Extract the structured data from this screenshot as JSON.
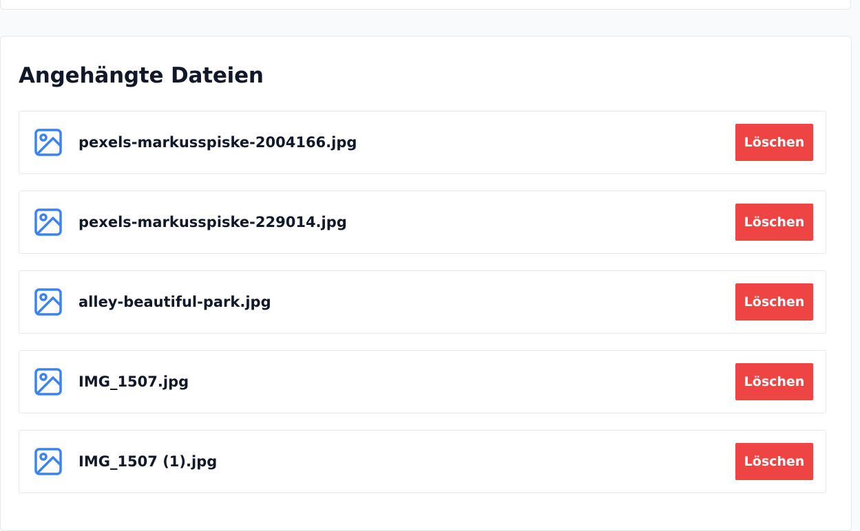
{
  "section": {
    "title": "Angehängte Dateien"
  },
  "colors": {
    "icon": "#3b82f6",
    "delete_button": "#ef4444"
  },
  "files": [
    {
      "name": "pexels-markusspiske-2004166.jpg",
      "icon": "image-icon",
      "delete_label": "Löschen"
    },
    {
      "name": "pexels-markusspiske-229014.jpg",
      "icon": "image-icon",
      "delete_label": "Löschen"
    },
    {
      "name": "alley-beautiful-park.jpg",
      "icon": "image-icon",
      "delete_label": "Löschen"
    },
    {
      "name": "IMG_1507.jpg",
      "icon": "image-icon",
      "delete_label": "Löschen"
    },
    {
      "name": "IMG_1507 (1).jpg",
      "icon": "image-icon",
      "delete_label": "Löschen"
    }
  ]
}
